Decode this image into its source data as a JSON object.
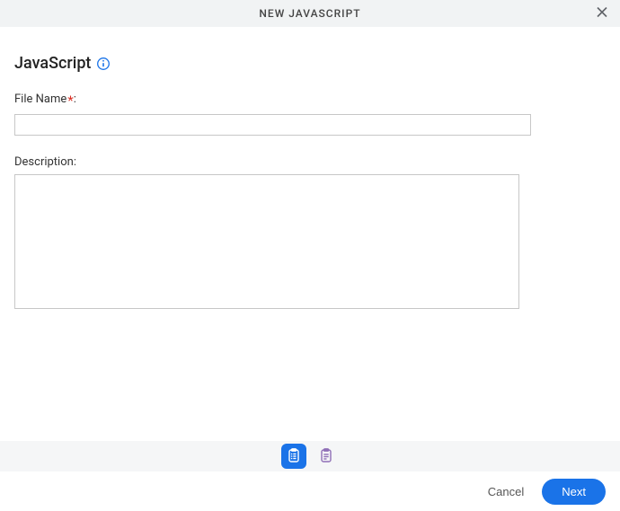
{
  "header": {
    "title": "NEW JAVASCRIPT"
  },
  "section": {
    "title": "JavaScript"
  },
  "fields": {
    "filename": {
      "label": "File Name",
      "value": ""
    },
    "description": {
      "label": "Description:",
      "value": ""
    }
  },
  "footer": {
    "cancel_label": "Cancel",
    "next_label": "Next"
  }
}
